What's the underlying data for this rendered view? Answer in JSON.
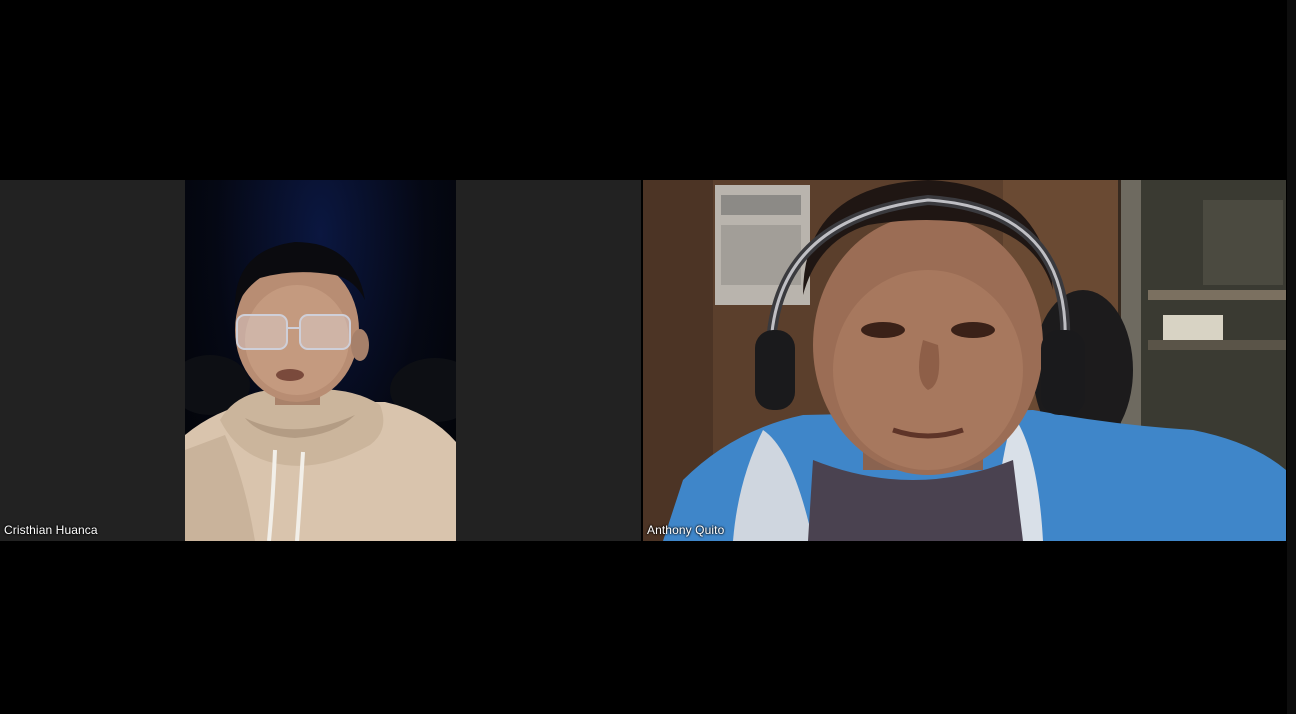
{
  "meeting": {
    "participants": [
      {
        "name": "Cristhian Huanca"
      },
      {
        "name": "Anthony Quito"
      }
    ]
  },
  "colors": {
    "background": "#000000",
    "tile_background": "#222222",
    "label_text": "#ffffff"
  },
  "icons": []
}
